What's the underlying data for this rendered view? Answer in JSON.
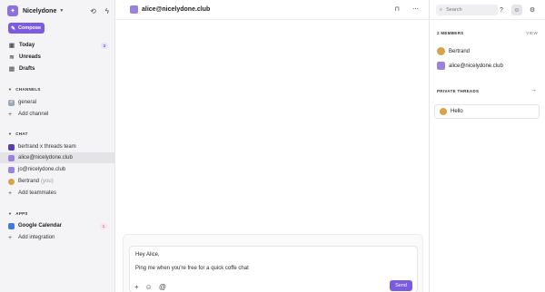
{
  "workspace": {
    "name": "Nicelydone"
  },
  "sidebar": {
    "compose_label": "Compose",
    "nav": [
      {
        "label": "Today",
        "badge": "2"
      },
      {
        "label": "Unreads"
      },
      {
        "label": "Drafts"
      }
    ],
    "channels_header": "CHANNELS",
    "channels": [
      {
        "label": "general"
      }
    ],
    "add_channel": "Add channel",
    "chat_header": "CHAT",
    "chats": [
      {
        "label": "bertrand x threads team"
      },
      {
        "label": "alice@nicelydone.club"
      },
      {
        "label": "jo@nicelydone.club"
      },
      {
        "label": "Bertrand",
        "suffix": "(you)"
      }
    ],
    "add_teammates": "Add teammates",
    "apps_header": "APPS",
    "apps": [
      {
        "label": "Google Calendar",
        "badge": "1"
      }
    ],
    "add_integration": "Add integration"
  },
  "main": {
    "title": "alice@nicelydone.club",
    "composer": {
      "line1": "Hey Alice,",
      "line2": "Ping me when you're free for a quick coffe chat",
      "send_label": "Send"
    }
  },
  "right": {
    "search_placeholder": "Search",
    "members_header": "2 MEMBERS",
    "view_label": "VIEW",
    "members": [
      {
        "label": "Bertrand"
      },
      {
        "label": "alice@nicelydone.club"
      }
    ],
    "threads_header": "PRIVATE THREADS",
    "threads": [
      {
        "label": "Hello"
      }
    ]
  },
  "colors": {
    "accent": "#7b5ce0",
    "sidebar_bg": "#f4f4f6"
  }
}
